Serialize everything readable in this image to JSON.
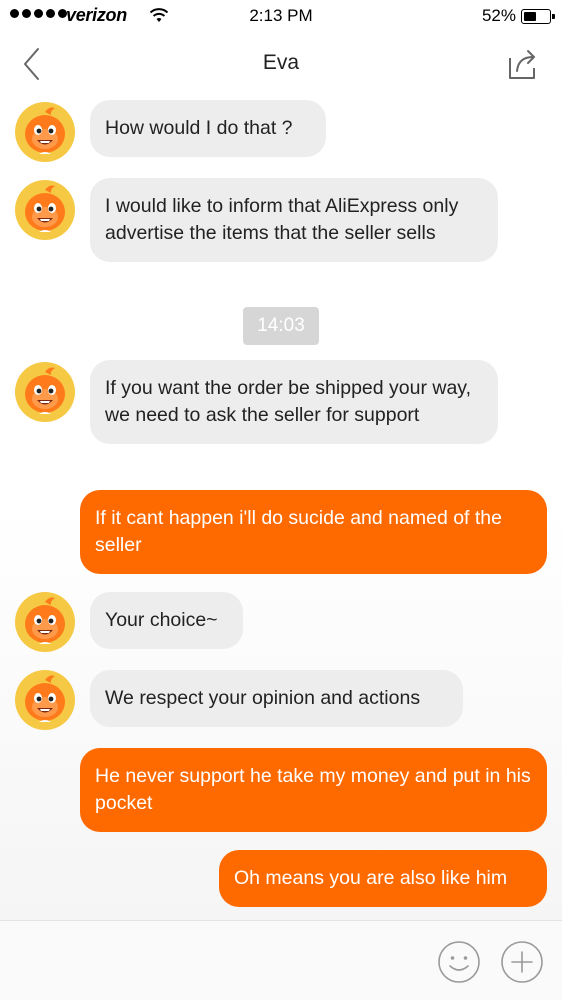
{
  "status_bar": {
    "carrier": "verizon",
    "time": "2:13 PM",
    "battery_percent": "52%",
    "battery_level": 0.52
  },
  "nav": {
    "title": "Eva",
    "back_icon": "chevron-left-icon",
    "share_icon": "share-icon"
  },
  "chat": {
    "timestamp": "14:03",
    "messages": [
      {
        "from": "agent",
        "text": "How would I do that ?"
      },
      {
        "from": "agent",
        "text": "I would like to inform that AliExpress only advertise the items that the seller sells"
      },
      {
        "from": "agent",
        "text": "If you want the order be shipped your way, we need to ask the seller for support"
      },
      {
        "from": "user",
        "text": "If it cant happen i'll do sucide and named of the seller"
      },
      {
        "from": "agent",
        "text": "Your choice~"
      },
      {
        "from": "agent",
        "text": "We respect your opinion and actions"
      },
      {
        "from": "user",
        "text": "He never support he take my money and put in his pocket"
      },
      {
        "from": "user",
        "text": "Oh means you are also like him"
      }
    ]
  },
  "input_bar": {
    "emoji_icon": "smiley-icon",
    "plus_icon": "plus-circle-icon"
  },
  "colors": {
    "outgoing_bubble": "#ff6a00",
    "incoming_bubble": "#ededed",
    "avatar_bg": "#f6c945",
    "mascot": "#ff7a1a"
  }
}
